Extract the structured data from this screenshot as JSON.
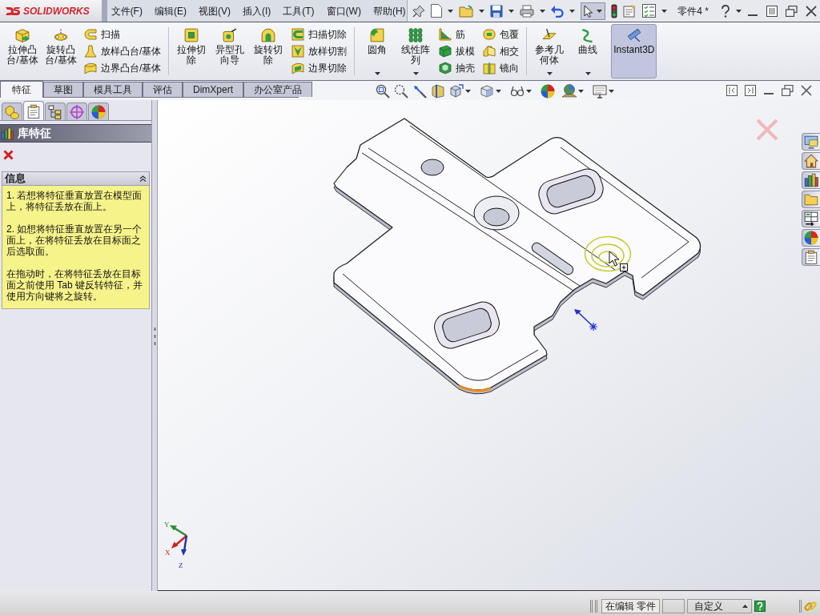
{
  "app": {
    "logo_text": "SOLIDWORKS"
  },
  "menu": [
    {
      "label": "文件(F)"
    },
    {
      "label": "编辑(E)"
    },
    {
      "label": "视图(V)"
    },
    {
      "label": "插入(I)"
    },
    {
      "label": "工具(T)"
    },
    {
      "label": "窗口(W)"
    },
    {
      "label": "帮助(H)"
    }
  ],
  "quick_access": {
    "select_tool_on": true
  },
  "document": {
    "title": "零件4 *"
  },
  "command_manager": {
    "sections": [
      {
        "columns": [
          {
            "kind": "large",
            "label": "拉伸凸台/基体",
            "dropdown": false,
            "on": false
          },
          {
            "kind": "large",
            "label": "旋转凸台/基体",
            "dropdown": false,
            "on": false
          },
          {
            "kind": "stack",
            "items": [
              {
                "label": "扫描"
              },
              {
                "label": "放样凸台/基体"
              },
              {
                "label": "边界凸台/基体"
              }
            ]
          }
        ]
      },
      {
        "columns": [
          {
            "kind": "large",
            "label": "拉伸切除",
            "dropdown": false,
            "on": false
          },
          {
            "kind": "large",
            "label": "异型孔向导",
            "dropdown": false,
            "on": false
          },
          {
            "kind": "large",
            "label": "旋转切除",
            "dropdown": false,
            "on": false
          },
          {
            "kind": "stack",
            "items": [
              {
                "label": "扫描切除"
              },
              {
                "label": "放样切割"
              },
              {
                "label": "边界切除"
              }
            ]
          }
        ]
      },
      {
        "columns": [
          {
            "kind": "large",
            "label": "圆角",
            "dropdown": true,
            "on": false
          },
          {
            "kind": "large",
            "label": "线性阵列",
            "dropdown": true,
            "on": false
          },
          {
            "kind": "stack",
            "items": [
              {
                "label": "筋"
              },
              {
                "label": "拔模"
              },
              {
                "label": "抽壳"
              }
            ]
          },
          {
            "kind": "stack",
            "items": [
              {
                "label": "包覆"
              },
              {
                "label": "相交"
              },
              {
                "label": "镜向"
              }
            ]
          }
        ]
      },
      {
        "columns": [
          {
            "kind": "large",
            "label": "参考几何体",
            "dropdown": true,
            "on": false
          },
          {
            "kind": "large",
            "label": "曲线",
            "dropdown": true,
            "on": false
          }
        ]
      },
      {
        "columns": [
          {
            "kind": "large",
            "label": "Instant3D",
            "dropdown": false,
            "on": true
          }
        ]
      }
    ]
  },
  "command_tabs": [
    {
      "label": "特征",
      "selected": true
    },
    {
      "label": "草图",
      "selected": false
    },
    {
      "label": "模具工具",
      "selected": false
    },
    {
      "label": "评估",
      "selected": false
    },
    {
      "label": "DimXpert",
      "selected": false
    },
    {
      "label": "办公室产品",
      "selected": false
    }
  ],
  "panel_tabs": [
    {
      "selected": false
    },
    {
      "selected": true
    },
    {
      "selected": false
    },
    {
      "selected": false
    },
    {
      "selected": false
    }
  ],
  "property_manager": {
    "title": "库特征",
    "groups": [
      {
        "title": "信息",
        "expanded": true,
        "paragraphs": [
          "1. 若想将特征垂直放置在模型面上，将特征丢放在面上。",
          "2. 如想将特征垂直放置在另一个面上，在将特征丢放在目标面之后选取面。",
          "在拖动时，在将特征丢放在目标面之前使用 Tab 键反转特征，并使用方向键将之旋转。"
        ]
      }
    ]
  },
  "graphics": {
    "triad_labels": [
      "Y",
      "X",
      "Z"
    ]
  },
  "status_bar": {
    "mode": "在编辑 零件",
    "units": "自定义"
  }
}
